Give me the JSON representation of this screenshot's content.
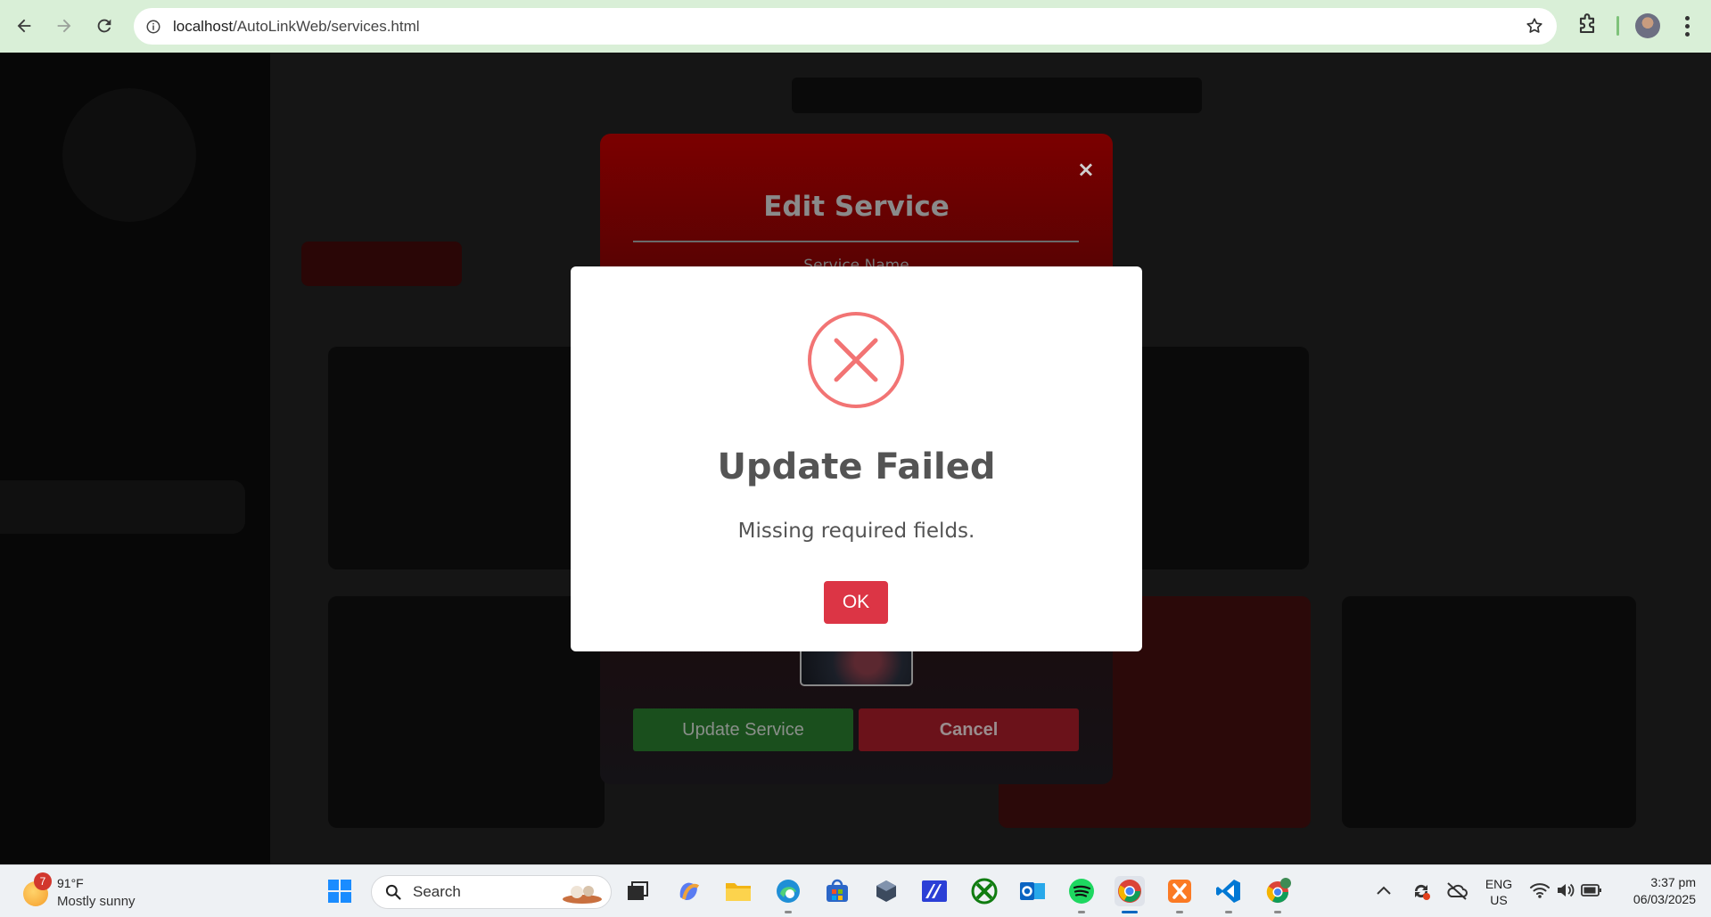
{
  "browser": {
    "url_host": "localhost",
    "url_path": "/AutoLinkWeb/services.html"
  },
  "edit_modal": {
    "title": "Edit Service",
    "close_symbol": "×",
    "field_label": "Service Name",
    "update_button": "Update Service",
    "cancel_button": "Cancel"
  },
  "alert": {
    "icon": "error-x-icon",
    "icon_color": "#f27474",
    "title": "Update Failed",
    "message": "Missing required fields.",
    "ok_button": "OK",
    "ok_color": "#dc3545"
  },
  "taskbar": {
    "weather": {
      "badge": "7",
      "temp": "91°F",
      "condition": "Mostly sunny"
    },
    "search_label": "Search",
    "tray": {
      "lang_top": "ENG",
      "lang_bottom": "US",
      "time": "3:37 pm",
      "date": "06/03/2025"
    }
  }
}
